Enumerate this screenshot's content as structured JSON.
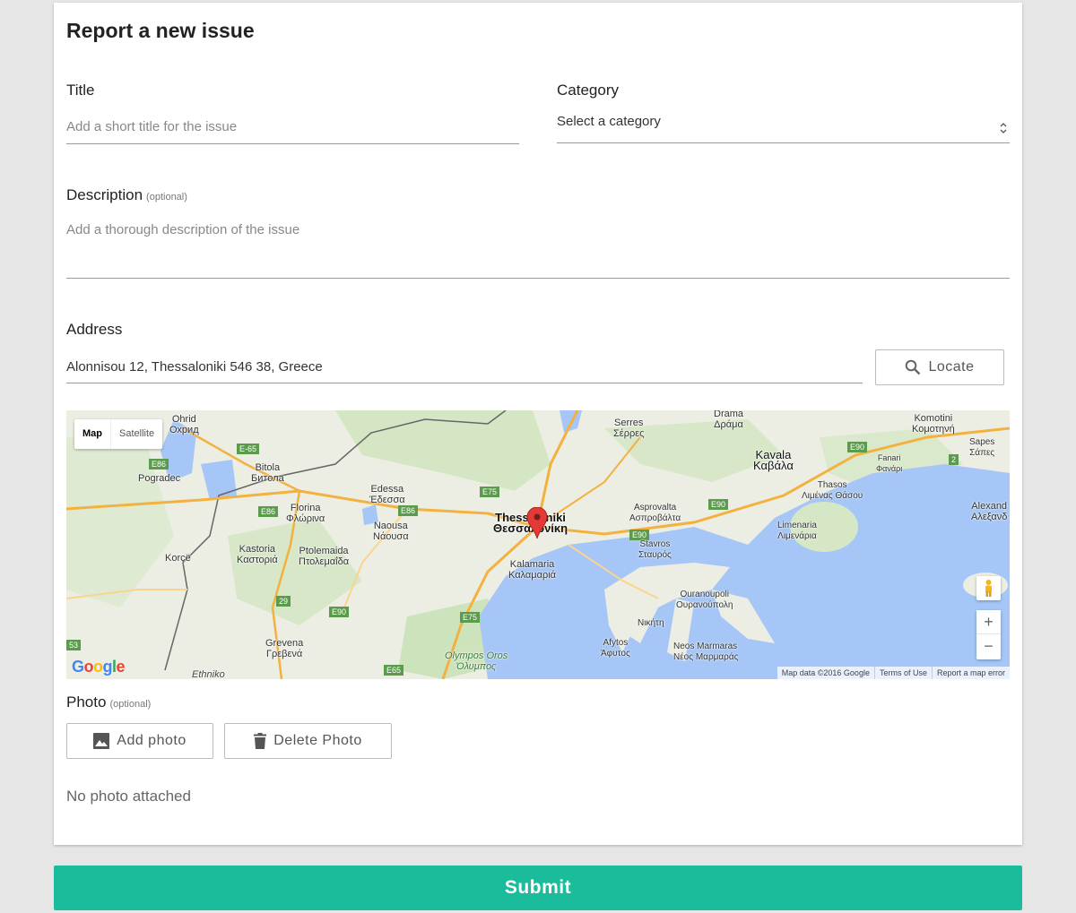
{
  "form": {
    "title": "Report a new issue",
    "title_field": {
      "label": "Title",
      "placeholder": "Add a short title for the issue"
    },
    "category_field": {
      "label": "Category",
      "selected": "Select a category"
    },
    "description_field": {
      "label": "Description",
      "optional": "(optional)",
      "placeholder": "Add a thorough description of the issue"
    },
    "address_field": {
      "label": "Address",
      "value": "Alonnisou 12, Thessaloniki 546 38, Greece"
    },
    "locate_label": "Locate",
    "photo": {
      "label": "Photo",
      "optional": "(optional)",
      "add_label": "Add photo",
      "delete_label": "Delete Photo",
      "status": "No photo attached"
    },
    "submit_label": "Submit"
  },
  "map": {
    "type_map": "Map",
    "type_satellite": "Satellite",
    "zoom_in": "+",
    "zoom_out": "−",
    "logo": "Google",
    "footer": {
      "data": "Map data ©2016 Google",
      "terms": "Terms of Use",
      "report": "Report a map error"
    },
    "places": [
      {
        "key": "thessaloniki",
        "name": "Thessaloniki",
        "local": "Θεσσαλονίκη"
      },
      {
        "key": "kalamaria",
        "name": "Kalamaria",
        "local": "Καλαμαριά"
      },
      {
        "key": "serres",
        "name": "Serres",
        "local": "Σέρρες"
      },
      {
        "key": "drama",
        "name": "Drama",
        "local": "Δράμα"
      },
      {
        "key": "komotini",
        "name": "Komotini",
        "local": "Κομοτηνή"
      },
      {
        "key": "kavala",
        "name": "Kavala",
        "local": "Καβάλα"
      },
      {
        "key": "sapes",
        "name": "Sapes",
        "local": "Σάπες"
      },
      {
        "key": "fanari",
        "name": "Fanari",
        "local": "Φανάρι"
      },
      {
        "key": "thasos",
        "name": "Thasos",
        "local": "Λιμένας Θάσου"
      },
      {
        "key": "alexand",
        "name": "Alexand",
        "local": "Αλεξανδ"
      },
      {
        "key": "limenaria",
        "name": "Limenaria",
        "local": "Λιμενάρια"
      },
      {
        "key": "asprovalta",
        "name": "Asprovalta",
        "local": "Ασπροβάλτα"
      },
      {
        "key": "stavros",
        "name": "Stavros",
        "local": "Σταυρός"
      },
      {
        "key": "ouranoupoli",
        "name": "Ouranoupoli",
        "local": "Ουρανούπολη"
      },
      {
        "key": "nikiti",
        "name": "Νικήτη",
        "local": ""
      },
      {
        "key": "afytos",
        "name": "Afytos",
        "local": "Άφυτος"
      },
      {
        "key": "neos",
        "name": "Neos Marmaras",
        "local": "Νέος Μαρμαράς"
      },
      {
        "key": "ohrid",
        "name": "Ohrid",
        "local": "Охрид"
      },
      {
        "key": "bitola",
        "name": "Bitola",
        "local": "Битола"
      },
      {
        "key": "pogradec",
        "name": "Pogradec",
        "local": ""
      },
      {
        "key": "edessa",
        "name": "Edessa",
        "local": "Έδεσσα"
      },
      {
        "key": "florina",
        "name": "Florina",
        "local": "Φλώρινα"
      },
      {
        "key": "naousa",
        "name": "Naousa",
        "local": "Νάουσα"
      },
      {
        "key": "kastoria",
        "name": "Kastoria",
        "local": "Καστοριά"
      },
      {
        "key": "ptolemaida",
        "name": "Ptolemaida",
        "local": "Πτολεμαΐδα"
      },
      {
        "key": "korce",
        "name": "Korçë",
        "local": ""
      },
      {
        "key": "grevena",
        "name": "Grevena",
        "local": "Γρεβενά"
      },
      {
        "key": "olympos",
        "name": "Olympos Oros",
        "local": "Όλυμπος"
      },
      {
        "key": "ethniko",
        "name": "Ethniko",
        "local": ""
      }
    ],
    "shields": [
      "E-65",
      "E86",
      "E86",
      "E86",
      "E75",
      "E90",
      "E90",
      "E90",
      "2",
      "29",
      "E90",
      "E75",
      "E65",
      "53"
    ]
  }
}
